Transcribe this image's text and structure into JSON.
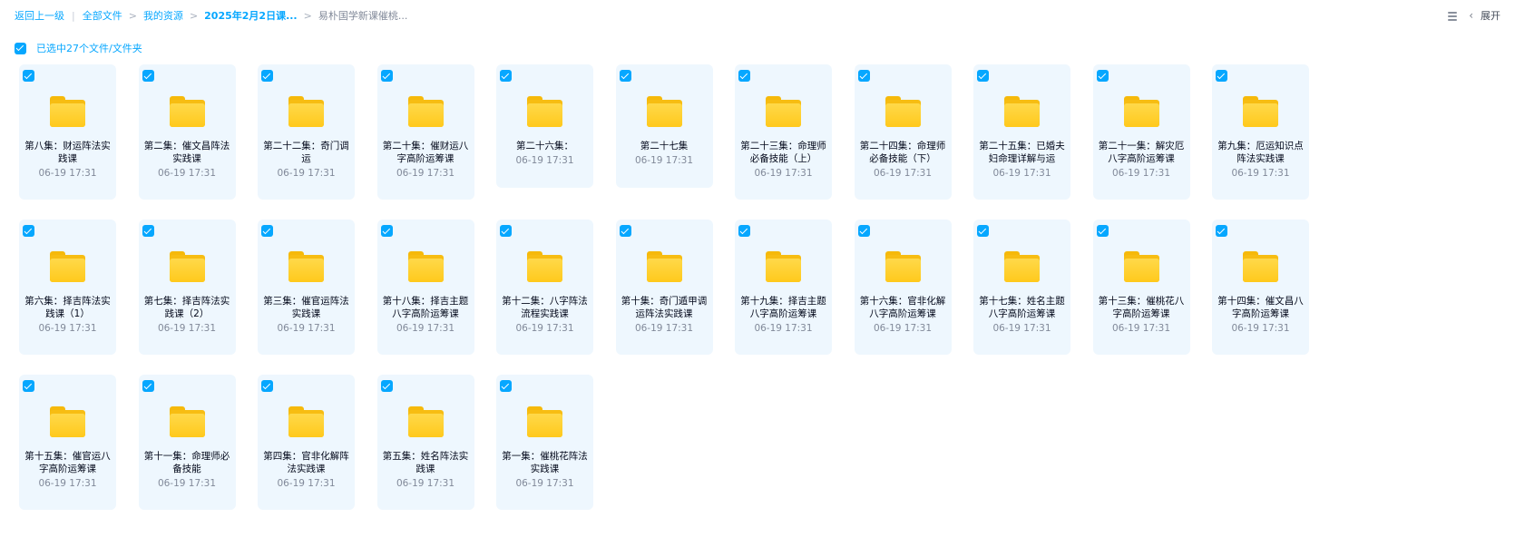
{
  "breadcrumb": {
    "back": "返回上一级",
    "all_files": "全部文件",
    "my_resources": "我的资源",
    "date_folder": "2025年2月2日课...",
    "current": "易朴国学新课催桃..."
  },
  "toolbar": {
    "expand_label": "展开"
  },
  "selection": {
    "text": "已选中27个文件/文件夹"
  },
  "files": [
    {
      "name": "第八集：财运阵法实践课",
      "date": "06-19 17:31"
    },
    {
      "name": "第二集：催文昌阵法实践课",
      "date": "06-19 17:31"
    },
    {
      "name": "第二十二集：奇门调运",
      "date": "06-19 17:31"
    },
    {
      "name": "第二十集：催财运八字高阶运筹课",
      "date": "06-19 17:31"
    },
    {
      "name": "第二十六集：",
      "date": "06-19 17:31"
    },
    {
      "name": "第二十七集",
      "date": "06-19 17:31"
    },
    {
      "name": "第二十三集：命理师必备技能（上）",
      "date": "06-19 17:31"
    },
    {
      "name": "第二十四集：命理师必备技能（下）",
      "date": "06-19 17:31"
    },
    {
      "name": "第二十五集：已婚夫妇命理详解与运",
      "date": "06-19 17:31"
    },
    {
      "name": "第二十一集：解灾厄八字高阶运筹课",
      "date": "06-19 17:31"
    },
    {
      "name": "第九集：厄运知识点阵法实践课",
      "date": "06-19 17:31"
    },
    {
      "name": "第六集：择吉阵法实践课（1）",
      "date": "06-19 17:31"
    },
    {
      "name": "第七集：择吉阵法实践课（2）",
      "date": "06-19 17:31"
    },
    {
      "name": "第三集：催官运阵法实践课",
      "date": "06-19 17:31"
    },
    {
      "name": "第十八集：择吉主题八字高阶运筹课",
      "date": "06-19 17:31"
    },
    {
      "name": "第十二集：八字阵法流程实践课",
      "date": "06-19 17:31"
    },
    {
      "name": "第十集：奇门遁甲调运阵法实践课",
      "date": "06-19 17:31"
    },
    {
      "name": "第十九集：择吉主题八字高阶运筹课",
      "date": "06-19 17:31"
    },
    {
      "name": "第十六集：官非化解八字高阶运筹课",
      "date": "06-19 17:31"
    },
    {
      "name": "第十七集：姓名主题八字高阶运筹课",
      "date": "06-19 17:31"
    },
    {
      "name": "第十三集：催桃花八字高阶运筹课",
      "date": "06-19 17:31"
    },
    {
      "name": "第十四集：催文昌八字高阶运筹课",
      "date": "06-19 17:31"
    },
    {
      "name": "第十五集：催官运八字高阶运筹课",
      "date": "06-19 17:31"
    },
    {
      "name": "第十一集：命理师必备技能",
      "date": "06-19 17:31"
    },
    {
      "name": "第四集：官非化解阵法实践课",
      "date": "06-19 17:31"
    },
    {
      "name": "第五集：姓名阵法实践课",
      "date": "06-19 17:31"
    },
    {
      "name": "第一集：催桃花阵法实践课",
      "date": "06-19 17:31"
    }
  ],
  "colors": {
    "accent": "#06a7ff",
    "card_bg": "#eef7fe",
    "folder": "#ffc91c"
  },
  "icons": {
    "list_view": "list-view-icon",
    "collapse": "chevron-left-icon",
    "folder": "folder-icon",
    "check": "checkbox-checked-icon"
  }
}
